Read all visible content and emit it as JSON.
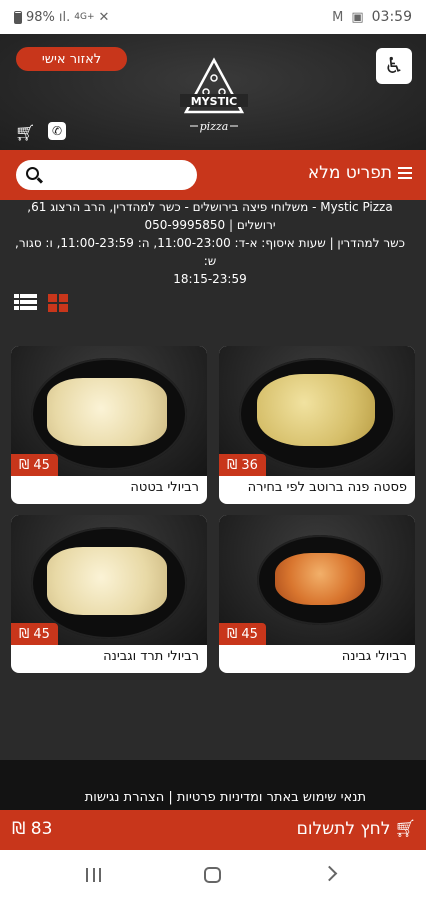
{
  "status_bar": {
    "battery": "98%",
    "network": "4G+",
    "time": "03:59"
  },
  "header": {
    "personal_area": "לאזור אישי",
    "logo_text": "MYSTIC",
    "logo_subtext": "pizza"
  },
  "menu_bar": {
    "title": "תפריט מלא",
    "search_placeholder": ""
  },
  "info": {
    "line1": "Mystic Pizza - משלוחי פיצה בירושלים - כשר למהדרין, הרב הרצוג 61,",
    "line2": "ירושלים | 050-9995850",
    "line3": "כשר למהדרין | שעות איסוף: א-ד: 11:00-23:00, ה: 11:00-23:59, ו: סגור, ש:",
    "line4": "18:15-23:59"
  },
  "products": [
    {
      "name": "פסטה פנה ברוטב לפי בחירה",
      "price": "36 ₪",
      "food": "penne"
    },
    {
      "name": "רביולי בטטה",
      "price": "45 ₪",
      "food": "ravioli"
    },
    {
      "name": "רביולי גבינה",
      "price": "45 ₪",
      "food": "ravioli-tomato"
    },
    {
      "name": "רביולי תרד וגבינה",
      "price": "45 ₪",
      "food": "ravioli"
    }
  ],
  "footer": {
    "links": "תנאי שימוש באתר ומדיניות פרטיות | הצהרת נגישות"
  },
  "pay_bar": {
    "label": "לחץ לתשלום",
    "total": "83 ₪"
  },
  "colors": {
    "accent": "#c8361b",
    "background": "#2b2b2b"
  }
}
